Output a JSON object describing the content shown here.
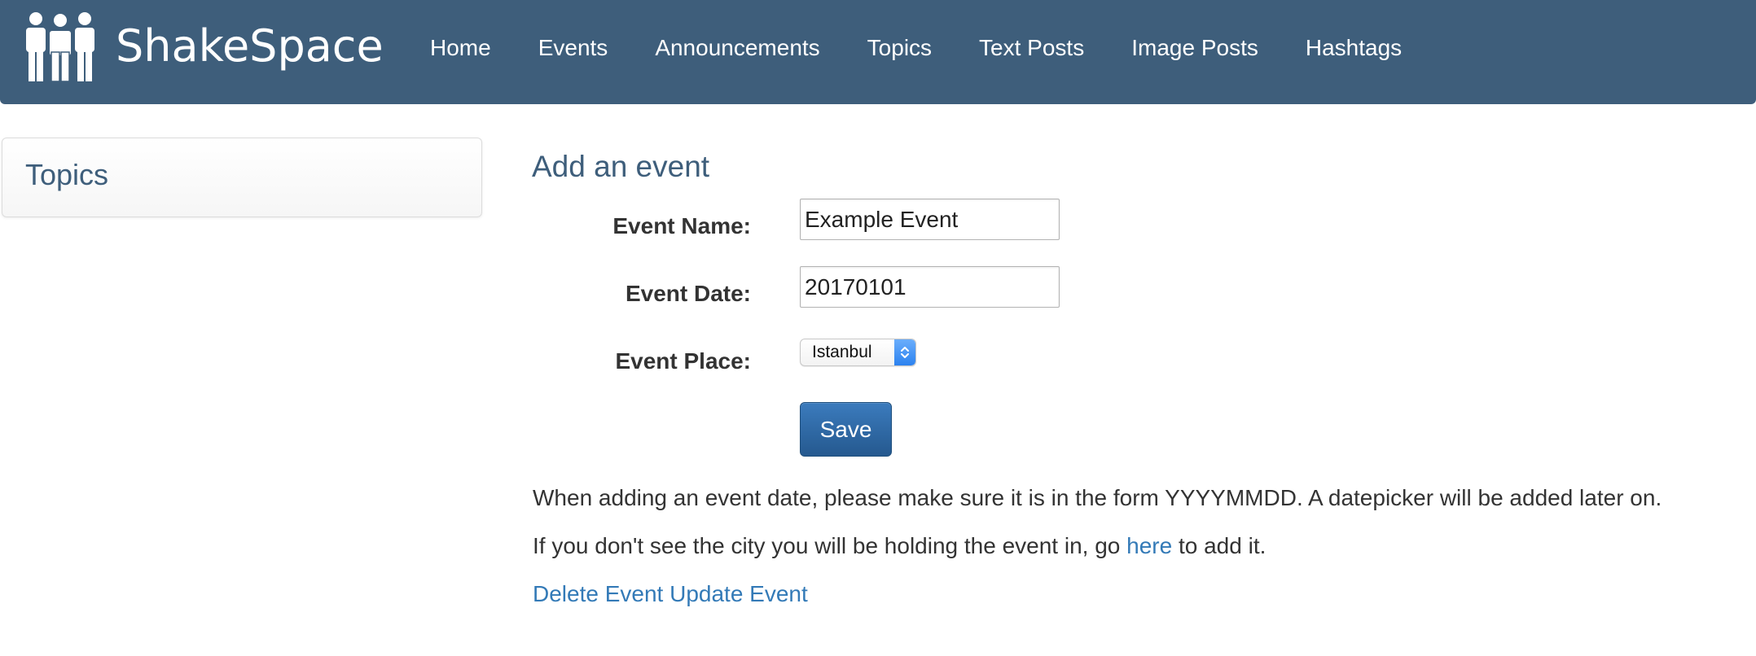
{
  "navbar": {
    "brand": "ShakeSpace",
    "logo_icon": "people-group-icon",
    "background_color": "#3e5e7b",
    "links": [
      "Home",
      "Events",
      "Announcements",
      "Topics",
      "Text Posts",
      "Image Posts",
      "Hashtags"
    ]
  },
  "sidebar": {
    "title": "Topics"
  },
  "form": {
    "title": "Add an event",
    "name_label": "Event Name:",
    "name_value": "Example Event",
    "date_label": "Event Date:",
    "date_value": "20170101",
    "place_label": "Event Place:",
    "place_selected": "Istanbul",
    "save_label": "Save",
    "accent_color": "#337ab7"
  },
  "help": {
    "date_note": "When adding an event date, please make sure it is in the form YYYYMMDD. A datepicker will be added later on.",
    "city_note_before": "If you don't see the city you will be holding the event in, go ",
    "city_note_link": "here",
    "city_note_after": " to add it."
  },
  "actions": {
    "delete_label": "Delete Event",
    "update_label": "Update Event"
  }
}
